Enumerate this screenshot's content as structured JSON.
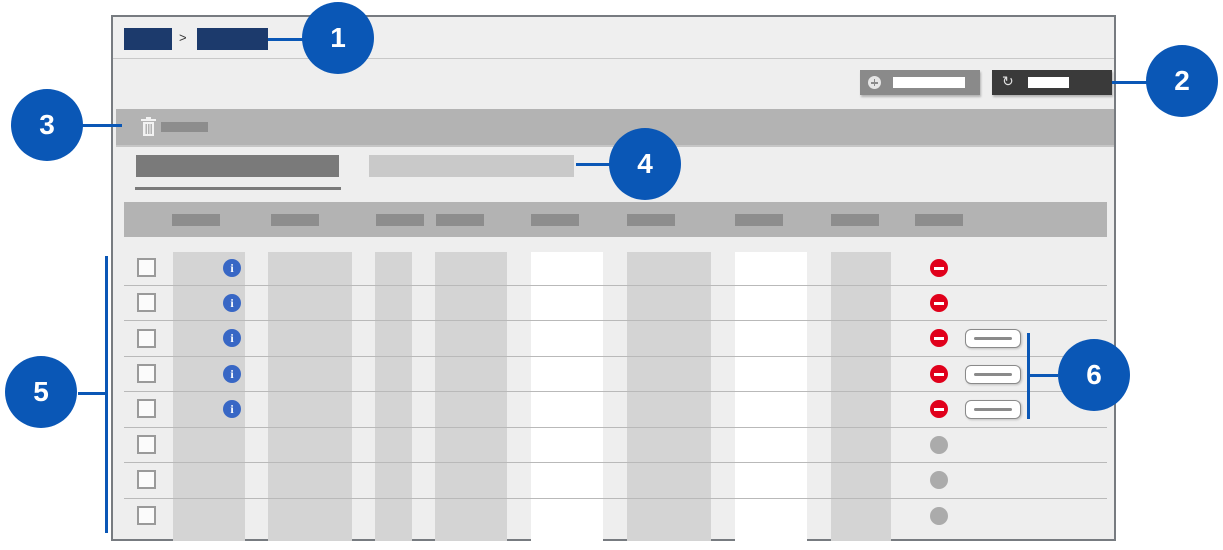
{
  "breadcrumb": {
    "separator": ">"
  },
  "refresh_button": {
    "icon": "refresh-icon",
    "glyph": "↻"
  },
  "add_button": {
    "icon": "plus-circle-icon"
  },
  "action_bar": {
    "icon": "trash-icon"
  },
  "table": {
    "row_count": 8,
    "rows": [
      {
        "info": "i",
        "status": "remove",
        "has_pill": false
      },
      {
        "info": "i",
        "status": "remove",
        "has_pill": false
      },
      {
        "info": "i",
        "status": "remove",
        "has_pill": true
      },
      {
        "info": "i",
        "status": "remove",
        "has_pill": true
      },
      {
        "info": "i",
        "status": "remove",
        "has_pill": true
      },
      {
        "info": "",
        "status": "inactive",
        "has_pill": false
      },
      {
        "info": "",
        "status": "inactive",
        "has_pill": false
      },
      {
        "info": "",
        "status": "inactive",
        "has_pill": false
      }
    ]
  },
  "callouts": [
    "1",
    "2",
    "3",
    "4",
    "5",
    "6"
  ],
  "colors": {
    "callout": "#0a57b6",
    "breadcrumb": "#1c3a6c",
    "remove": "#e0001b",
    "info": "#3867c5"
  }
}
